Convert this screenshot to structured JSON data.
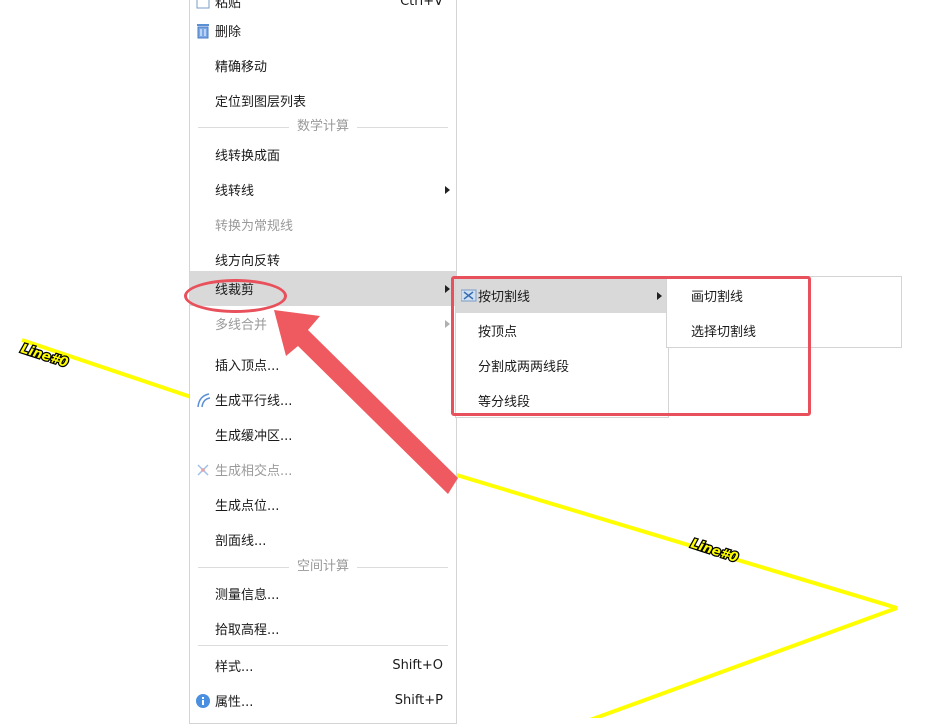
{
  "canvas": {
    "line_label_1": "Line#0",
    "line_label_2": "Line#0",
    "line_color": "#ffff00",
    "annotation_color": "#e8505b"
  },
  "main_menu": {
    "top_partial": {
      "label": "粘贴",
      "shortcut": "Ctrl+V"
    },
    "items_a": [
      {
        "label": "删除",
        "icon": "trash-icon"
      },
      {
        "label": "精确移动"
      },
      {
        "label": "定位到图层列表"
      }
    ],
    "section_math": "数学计算",
    "items_b": [
      {
        "label": "线转换成面"
      },
      {
        "label": "线转线",
        "submenu": true
      },
      {
        "label": "转换为常规线",
        "disabled": true
      },
      {
        "label": "线方向反转"
      },
      {
        "label": "线裁剪",
        "submenu": true,
        "highlighted": true
      },
      {
        "label": "多线合并",
        "submenu": true,
        "disabled": true
      },
      {
        "label": "插入顶点..."
      },
      {
        "label": "生成平行线...",
        "icon": "parallel-lines-icon"
      },
      {
        "label": "生成缓冲区..."
      },
      {
        "label": "生成相交点...",
        "icon": "intersection-icon",
        "disabled": true
      },
      {
        "label": "生成点位..."
      },
      {
        "label": "剖面线..."
      }
    ],
    "section_spatial": "空间计算",
    "items_c": [
      {
        "label": "测量信息..."
      },
      {
        "label": "拾取高程..."
      }
    ],
    "items_d": [
      {
        "label": "样式...",
        "shortcut": "Shift+O"
      },
      {
        "label": "属性...",
        "shortcut": "Shift+P",
        "icon": "info-icon"
      }
    ]
  },
  "submenu": {
    "items": [
      {
        "label": "按切割线",
        "icon": "scissors-icon",
        "submenu": true,
        "highlighted": true
      },
      {
        "label": "按顶点"
      },
      {
        "label": "分割成两两线段"
      },
      {
        "label": "等分线段"
      }
    ]
  },
  "submenu2": {
    "items": [
      {
        "label": "画切割线"
      },
      {
        "label": "选择切割线"
      }
    ]
  }
}
